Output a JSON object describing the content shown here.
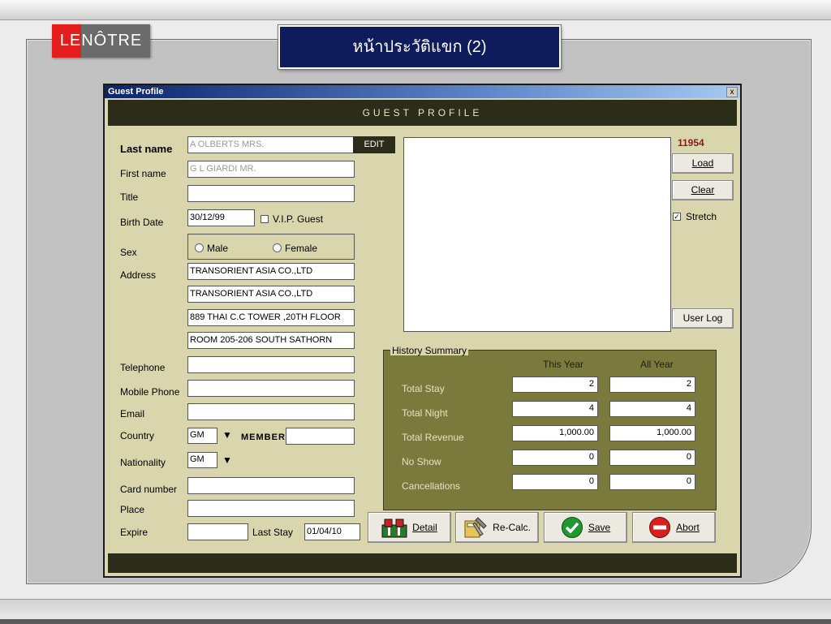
{
  "slide": {
    "logo_text": "LENÔTRE",
    "title": "หน้าประวัติแขก (2)"
  },
  "window": {
    "title": "Guest Profile",
    "close": "x",
    "banner": "GUEST PROFILE",
    "record_id": "11954"
  },
  "form": {
    "last_name": {
      "label": "Last name",
      "value": "A OLBERTS MRS."
    },
    "edit_label": "EDIT",
    "first_name": {
      "label": "First name",
      "value": "G L GIARDI MR."
    },
    "title": {
      "label": "Title",
      "value": ""
    },
    "birth_date": {
      "label": "Birth Date",
      "value": "30/12/99"
    },
    "vip": {
      "label": "V.I.P. Guest",
      "checked": false
    },
    "sex": {
      "label": "Sex",
      "male": "Male",
      "female": "Female"
    },
    "address": {
      "label": "Address",
      "lines": [
        "TRANSORIENT ASIA CO.,LTD",
        "TRANSORIENT ASIA CO.,LTD",
        "889 THAI C.C TOWER ,20TH FLOOR",
        "ROOM 205-206 SOUTH SATHORN"
      ]
    },
    "telephone": {
      "label": "Telephone",
      "value": ""
    },
    "mobile_phone": {
      "label": "Mobile Phone",
      "value": ""
    },
    "email": {
      "label": "Email",
      "value": ""
    },
    "country": {
      "label": "Country",
      "value": "GM"
    },
    "member": {
      "label": "MEMBER",
      "value": ""
    },
    "nationality": {
      "label": "Nationality",
      "value": "GM"
    },
    "card_number": {
      "label": "Card number",
      "value": ""
    },
    "place": {
      "label": "Place",
      "value": ""
    },
    "expire": {
      "label": "Expire",
      "value": ""
    },
    "last_stay": {
      "label": "Last Stay",
      "value": "01/04/10"
    }
  },
  "side_buttons": {
    "load": "Load",
    "clear": "Clear",
    "stretch": {
      "label": "Stretch",
      "checked": true
    },
    "user_log": "User Log"
  },
  "history": {
    "legend": "History Summary",
    "col_this_year": "This Year",
    "col_all_year": "All Year",
    "rows": [
      {
        "label": "Total Stay",
        "this_year": "2",
        "all_year": "2"
      },
      {
        "label": "Total Night",
        "this_year": "4",
        "all_year": "4"
      },
      {
        "label": "Total Revenue",
        "this_year": "1,000.00",
        "all_year": "1,000.00"
      },
      {
        "label": "No Show",
        "this_year": "0",
        "all_year": "0"
      },
      {
        "label": "Cancellations",
        "this_year": "0",
        "all_year": "0"
      }
    ]
  },
  "actions": {
    "detail": "Detail",
    "recalc": "Re-Calc.",
    "save": "Save",
    "abort": "Abort"
  }
}
